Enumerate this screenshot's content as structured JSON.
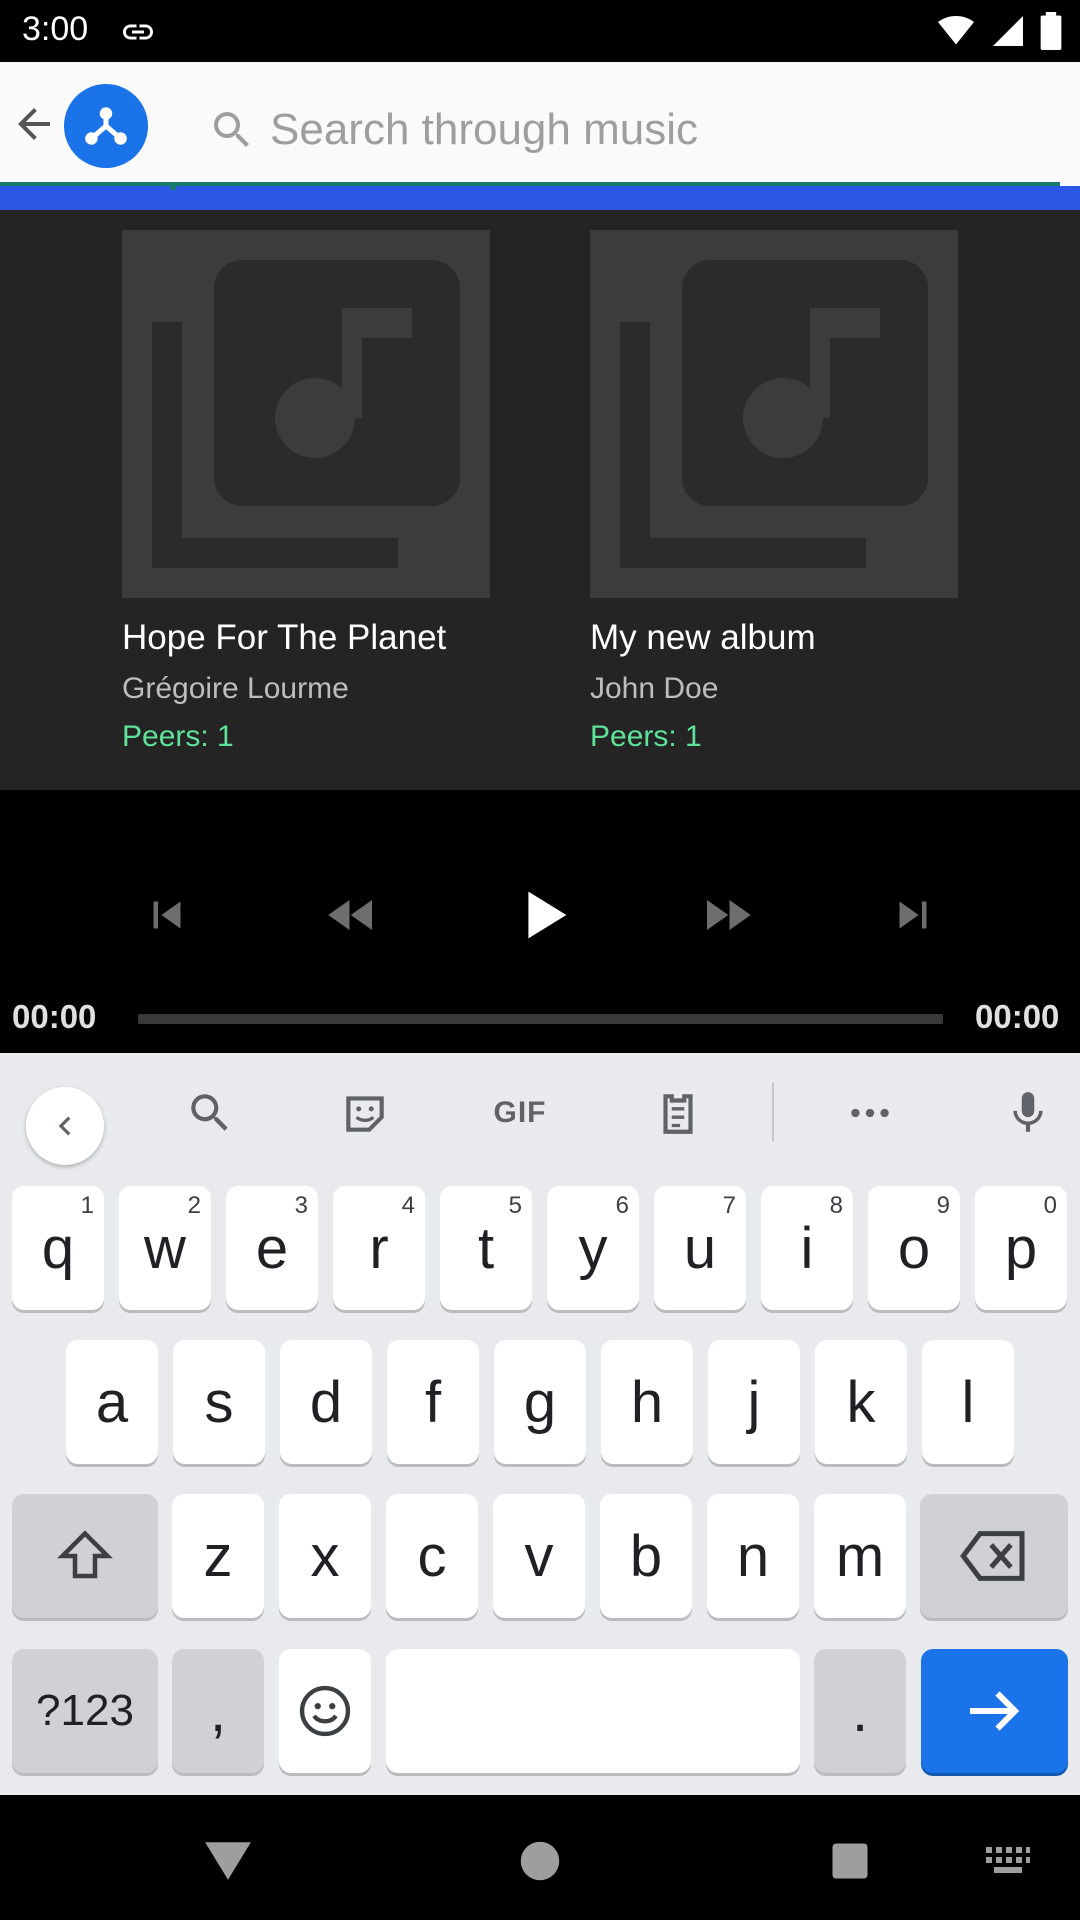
{
  "status": {
    "time": "3:00"
  },
  "search": {
    "placeholder": "Search through music"
  },
  "albums": [
    {
      "title": "Hope For The Planet",
      "artist": "Grégoire Lourme",
      "peers": "Peers: 1"
    },
    {
      "title": "My new album",
      "artist": "John Doe",
      "peers": "Peers: 1"
    }
  ],
  "player": {
    "elapsed": "00:00",
    "duration": "00:00",
    "progress": 0
  },
  "keyboard": {
    "toolbar": {
      "gif_label": "GIF"
    },
    "row1": [
      {
        "k": "q",
        "h": "1"
      },
      {
        "k": "w",
        "h": "2"
      },
      {
        "k": "e",
        "h": "3"
      },
      {
        "k": "r",
        "h": "4"
      },
      {
        "k": "t",
        "h": "5"
      },
      {
        "k": "y",
        "h": "6"
      },
      {
        "k": "u",
        "h": "7"
      },
      {
        "k": "i",
        "h": "8"
      },
      {
        "k": "o",
        "h": "9"
      },
      {
        "k": "p",
        "h": "0"
      }
    ],
    "row2": [
      "a",
      "s",
      "d",
      "f",
      "g",
      "h",
      "j",
      "k",
      "l"
    ],
    "row3": [
      "z",
      "x",
      "c",
      "v",
      "b",
      "n",
      "m"
    ],
    "symbols_label": "?123",
    "comma": ",",
    "period": "."
  },
  "colors": {
    "accent": "#1a73e8",
    "peers": "#5ee29a",
    "progress_strip": "#2a57e6"
  }
}
